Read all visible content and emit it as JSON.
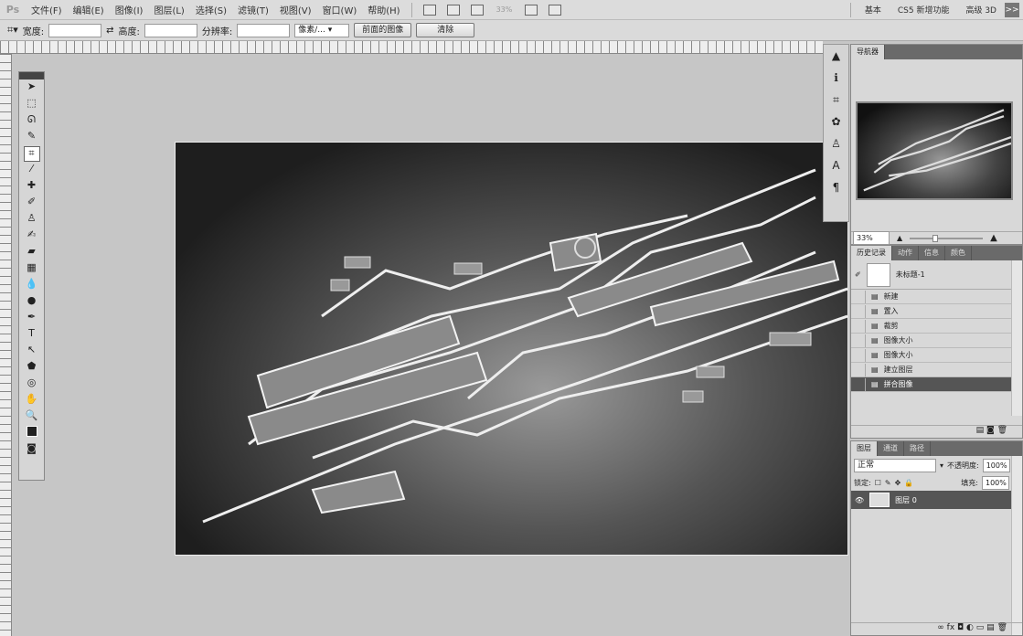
{
  "menubar": {
    "logo": "Ps",
    "items": [
      "文件(F)",
      "编辑(E)",
      "图像(I)",
      "图层(L)",
      "选择(S)",
      "滤镜(T)",
      "视图(V)",
      "窗口(W)",
      "帮助(H)"
    ],
    "zoom": "33%",
    "workspaces": [
      "基本",
      "CS5 新增功能",
      "高级 3D"
    ],
    "more": ">>"
  },
  "options": {
    "width_label": "宽度:",
    "width_value": "",
    "height_label": "高度:",
    "height_value": "",
    "resolution_label": "分辨率:",
    "resolution_value": "",
    "unit": "像素/...",
    "front_image": "前面的图像",
    "clear": "清除"
  },
  "navigator": {
    "tab": "导航器",
    "zoom": "33%"
  },
  "history": {
    "tabs": [
      "历史记录",
      "动作",
      "信息",
      "颜色"
    ],
    "snapshot": "未标题-1",
    "items": [
      "新建",
      "置入",
      "裁剪",
      "图像大小",
      "图像大小",
      "建立图层",
      "拼合图像"
    ],
    "selected_index": 6
  },
  "layers": {
    "tabs": [
      "图层",
      "通道",
      "路径"
    ],
    "blend_mode": "正常",
    "opacity_label": "不透明度:",
    "opacity": "100%",
    "lock_label": "锁定:",
    "fill_label": "填充:",
    "fill": "100%",
    "layer_name": "图层 0"
  }
}
